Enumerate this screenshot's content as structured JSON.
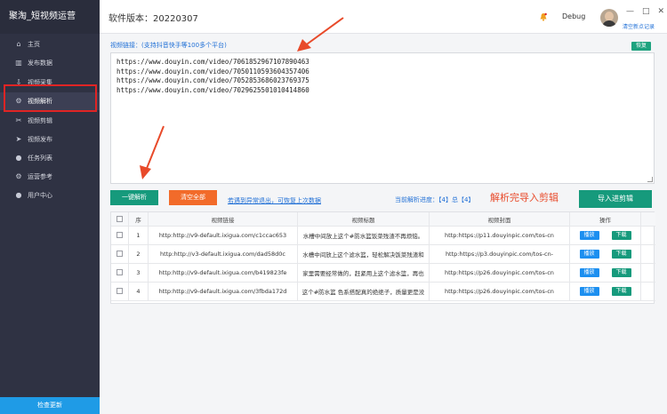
{
  "app": {
    "title": "聚淘_短视频运营",
    "version": "软件版本：20220307",
    "debug_label": "Debug",
    "clear_cache": "清空新点记录",
    "window_controls": [
      "—",
      "□",
      "✕"
    ]
  },
  "sidebar": {
    "items": [
      {
        "label": "主页",
        "icon": "home-icon"
      },
      {
        "label": "发布数据",
        "icon": "bar-chart-icon"
      },
      {
        "label": "视频采集",
        "icon": "download-icon"
      },
      {
        "label": "视频解析",
        "icon": "gear-icon"
      },
      {
        "label": "视频剪辑",
        "icon": "scissors-icon"
      },
      {
        "label": "视频发布",
        "icon": "send-icon"
      },
      {
        "label": "任务列表",
        "icon": "person-icon"
      },
      {
        "label": "运营参考",
        "icon": "gear-icon"
      },
      {
        "label": "用户中心",
        "icon": "person-icon"
      }
    ],
    "active_index": 3,
    "check_update": "检查更新"
  },
  "editor": {
    "label": "视频链接：(支持抖音快手等100多个平台)",
    "restore_label": "恢复",
    "links": [
      "https://www.douyin.com/video/7061852967107890463",
      "https://www.douyin.com/video/7050110593604357406",
      "https://www.douyin.com/video/7052853686023769375",
      "https://www.douyin.com/video/7029625501010414860"
    ]
  },
  "actions": {
    "parse_all": "一键解析",
    "clear_all": "清空全部",
    "recover_link": "若遇到异常退出，可恢复上次数据",
    "progress": "当前解析进度：【4】总【4】",
    "import_title": "解析完导入剪辑",
    "import_button": "导入进剪辑"
  },
  "table": {
    "headers": [
      "序",
      "视频链接",
      "视频标题",
      "视频封面",
      "操作"
    ],
    "play_label": "播放",
    "download_label": "下载",
    "rows": [
      {
        "idx": "1",
        "link": "http:http://v9-default.ixigua.com/c1ccac653",
        "title": "水槽中间放上这个#防水篮饭菜残渣不再烦恼。",
        "cover": "http:https://p11.douyinpic.com/tos-cn"
      },
      {
        "idx": "2",
        "link": "http:http://v3-default.ixigua.com/dad58d0c",
        "title": "水槽中间放上这个滤水篮，轻松解决饭菜残渣和",
        "cover": "http:https://p3.douyinpic.com/tos-cn-"
      },
      {
        "idx": "3",
        "link": "http:http://v9-default.ixigua.com/b419823fe",
        "title": "家里需要经常做的，赶紧用上这个滤水篮，再也",
        "cover": "http:https://p26.douyinpic.com/tos-cn"
      },
      {
        "idx": "4",
        "link": "http:http://v9-default.ixigua.com/3fbda172d",
        "title": "这个#防水篮 色系搭配真的绝绝子，质量更是没",
        "cover": "http:https://p26.douyinpic.com/tos-cn"
      }
    ]
  },
  "colors": {
    "sidebar_bg": "#2f3243",
    "accent_green": "#169a7c",
    "accent_orange": "#f26b2a",
    "accent_blue": "#1c8ff0",
    "annotation_red": "#e84a2a"
  }
}
